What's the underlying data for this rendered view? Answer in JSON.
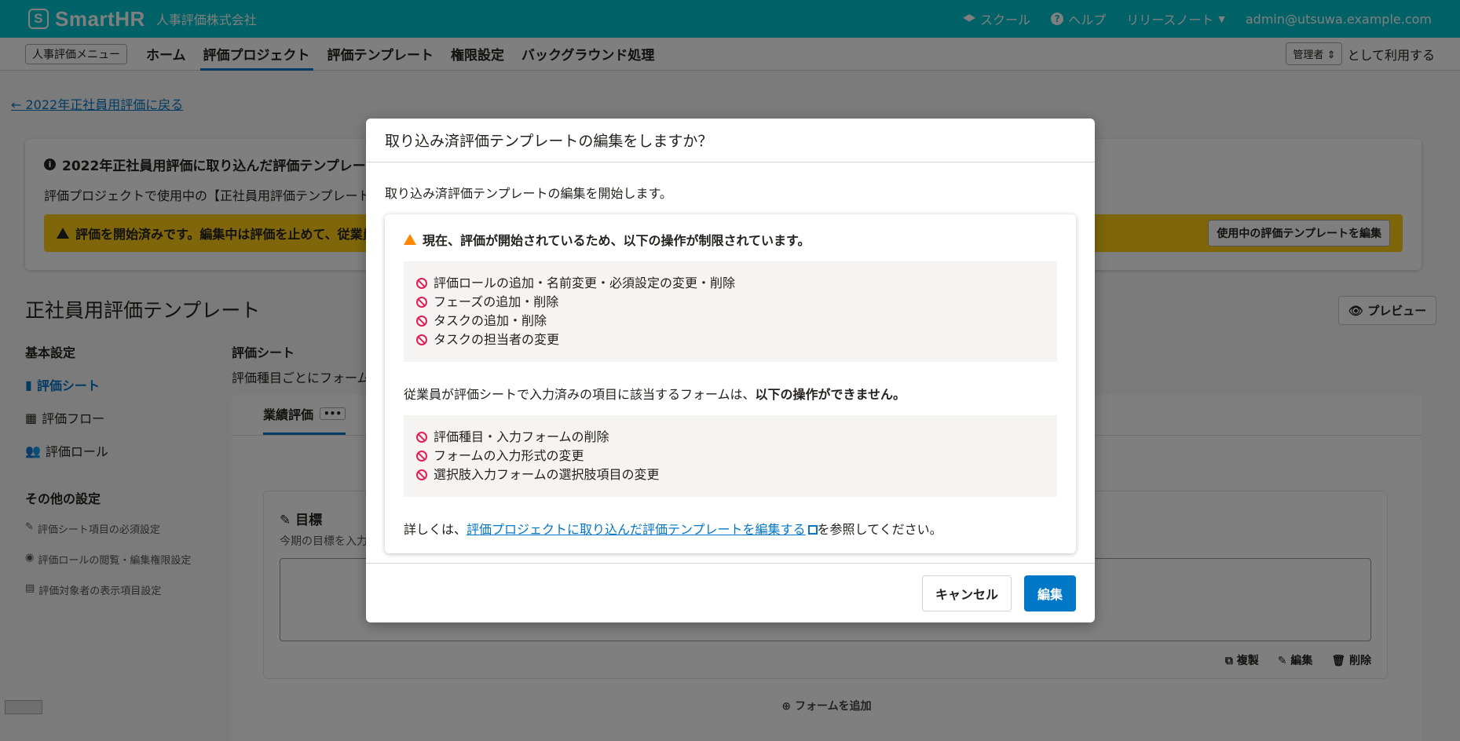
{
  "header": {
    "logo": "SmartHR",
    "logo_mark": "S",
    "company": "人事評価株式会社",
    "school": "スクール",
    "help": "ヘルプ",
    "release_notes": "リリースノート",
    "user": "admin@utsuwa.example.com"
  },
  "subnav": {
    "menu_button": "人事評価メニュー",
    "items": [
      "ホーム",
      "評価プロジェクト",
      "評価テンプレート",
      "権限設定",
      "バックグラウンド処理"
    ],
    "role": "管理者",
    "role_suffix": "として利用する"
  },
  "page": {
    "back_link": "2022年正社員用評価に戻る",
    "info_title": "2022年正社員用評価に取り込んだ評価テンプレートを",
    "info_text": "評価プロジェクトで使用中の【正社員用評価テンプレート",
    "warn_text": "評価を開始済みです。編集中は評価を止めて、従業員",
    "edit_template_button": "使用中の評価テンプレートを編集",
    "title": "正社員用評価テンプレート",
    "preview": "プレビュー",
    "sheet_title": "評価シート",
    "sheet_desc": "評価種目ごとにフォーム",
    "tab": "業績評価",
    "tab_more": "•••",
    "form_title": "目標",
    "form_sub": "今期の目標を入力",
    "duplicate": "複製",
    "edit": "編集",
    "delete": "削除",
    "add_form": "フォームを追加"
  },
  "sidebar": {
    "basic_heading": "基本設定",
    "items": [
      "評価シート",
      "評価フロー",
      "評価ロール"
    ],
    "other_heading": "その他の設定",
    "sub_items": [
      "評価シート項目の必須設定",
      "評価ロールの閲覧・編集権限設定",
      "評価対象者の表示項目設定"
    ]
  },
  "dialog": {
    "title": "取り込み済評価テンプレートの編集をしますか？",
    "intro": "取り込み済評価テンプレートの編集を開始します。",
    "notice_title": "現在、評価が開始されているため、以下の操作が制限されています。",
    "restricted": [
      "評価ロールの追加・名前変更・必須設定の変更・削除",
      "フェーズの追加・削除",
      "タスクの追加・削除",
      "タスクの担当者の変更"
    ],
    "para_normal": "従業員が評価シートで入力済みの項目に該当するフォームは、",
    "para_bold": "以下の操作ができません。",
    "restricted2": [
      "評価種目・入力フォームの削除",
      "フォームの入力形式の変更",
      "選択肢入力フォームの選択肢項目の変更"
    ],
    "detail_prefix": "詳しくは、",
    "detail_link": "評価プロジェクトに取り込んだ評価テンプレートを編集する",
    "detail_suffix": "を参照してください。",
    "cancel": "キャンセル",
    "confirm": "編集"
  }
}
